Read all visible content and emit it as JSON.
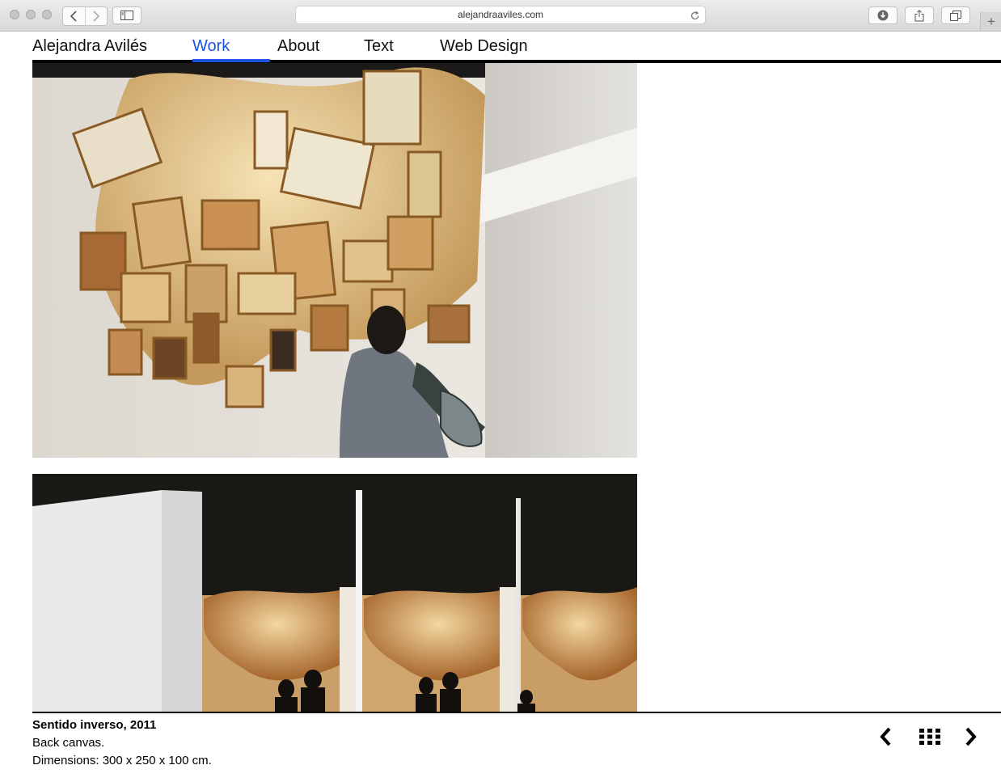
{
  "browser": {
    "url": "alejandraaviles.com"
  },
  "nav": {
    "brand": "Alejandra Avilés",
    "items": [
      {
        "label": "Work",
        "active": true
      },
      {
        "label": "About",
        "active": false
      },
      {
        "label": "Text",
        "active": false
      },
      {
        "label": "Web Design",
        "active": false
      }
    ],
    "accent_color": "#1a55e0"
  },
  "artwork": {
    "title": "Sentido inverso, 2011",
    "medium": "Back canvas.",
    "dimensions": "Dimensions: 300 x 250 x 100 cm."
  },
  "icons": {
    "previous": "chevron-left-icon",
    "grid": "grid-icon",
    "next": "chevron-right-icon"
  }
}
